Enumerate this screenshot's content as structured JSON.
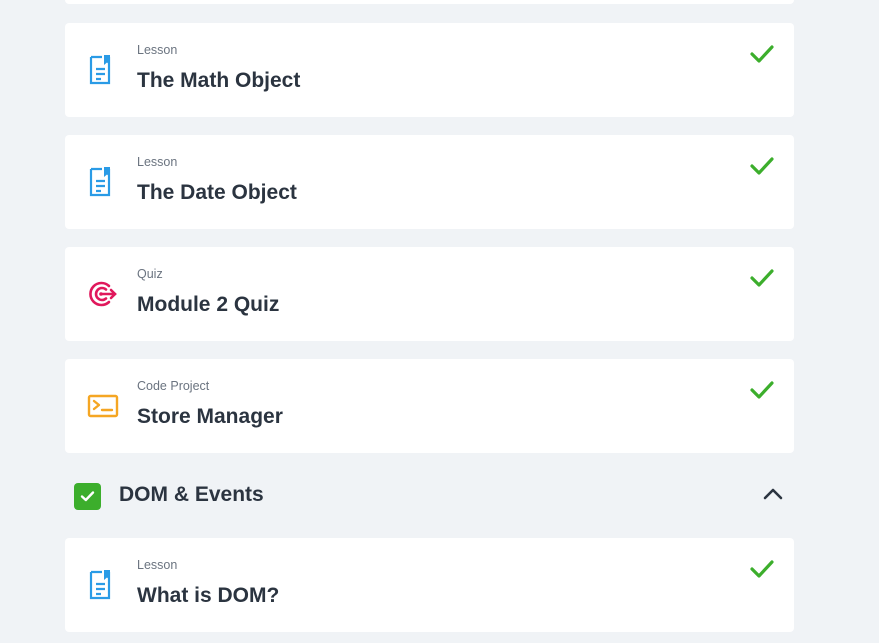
{
  "items": [
    {
      "kind": "Lesson",
      "title": "The Math Object",
      "icon": "document-icon",
      "status": "completed"
    },
    {
      "kind": "Lesson",
      "title": "The Date Object",
      "icon": "document-icon",
      "status": "completed"
    },
    {
      "kind": "Quiz",
      "title": "Module 2 Quiz",
      "icon": "target-icon",
      "status": "completed"
    },
    {
      "kind": "Code Project",
      "title": "Store Manager",
      "icon": "terminal-icon",
      "status": "completed"
    }
  ],
  "section": {
    "title": "DOM & Events",
    "status": "completed",
    "expanded": true
  },
  "section_items": [
    {
      "kind": "Lesson",
      "title": "What is DOM?",
      "icon": "document-icon",
      "status": "completed"
    }
  ],
  "colors": {
    "background": "#f0f3f6",
    "card": "#ffffff",
    "check": "#3cae2c",
    "lesson_icon": "#2a9be6",
    "quiz_icon": "#e0185c",
    "project_icon": "#f5a623",
    "title_text": "#2b3440",
    "kind_text": "#6b7480"
  }
}
